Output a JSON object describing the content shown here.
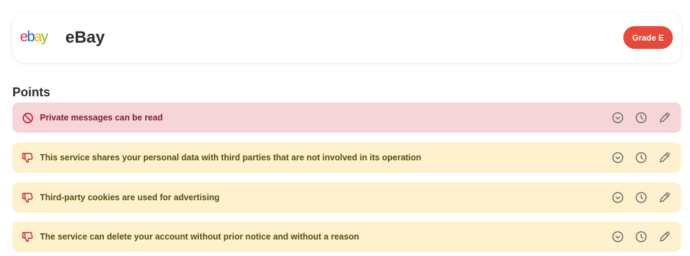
{
  "service": {
    "logo_letters": [
      "e",
      "b",
      "a",
      "y"
    ],
    "logo_colors": [
      "#e53238",
      "#0064d2",
      "#f5af02",
      "#86b817"
    ],
    "name": "eBay",
    "grade": "Grade E",
    "grade_color": "#e4493a"
  },
  "points_section": {
    "title": "Points"
  },
  "points": [
    {
      "label": "Private messages can be read",
      "kind": "blocker",
      "kind_icon": "prohibited-icon"
    },
    {
      "label": "This service shares your personal data with third parties that are not involved in its operation",
      "kind": "bad",
      "kind_icon": "thumbs-down-icon"
    },
    {
      "label": "Third-party cookies are used for advertising",
      "kind": "bad",
      "kind_icon": "thumbs-down-icon"
    },
    {
      "label": "The service can delete your account without prior notice and without a reason",
      "kind": "bad",
      "kind_icon": "thumbs-down-icon"
    }
  ],
  "point_actions": [
    "expand-chevron-icon",
    "history-clock-icon",
    "edit-pencil-icon"
  ],
  "colors": {
    "blocker_bg": "#f6d5d9",
    "bad_bg": "#fdf2cd",
    "icon_red": "#c8202f",
    "action_gray": "#6b6b6b"
  }
}
